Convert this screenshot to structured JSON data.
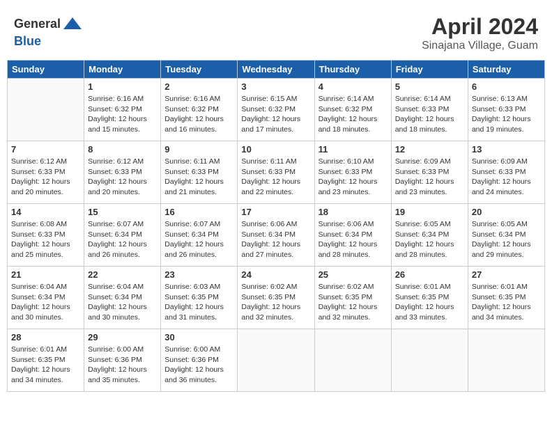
{
  "header": {
    "logo": {
      "line1": "General",
      "line2": "Blue"
    },
    "title": "April 2024",
    "location": "Sinajana Village, Guam"
  },
  "weekdays": [
    "Sunday",
    "Monday",
    "Tuesday",
    "Wednesday",
    "Thursday",
    "Friday",
    "Saturday"
  ],
  "weeks": [
    [
      {
        "day": "",
        "info": ""
      },
      {
        "day": "1",
        "info": "Sunrise: 6:16 AM\nSunset: 6:32 PM\nDaylight: 12 hours\nand 15 minutes."
      },
      {
        "day": "2",
        "info": "Sunrise: 6:16 AM\nSunset: 6:32 PM\nDaylight: 12 hours\nand 16 minutes."
      },
      {
        "day": "3",
        "info": "Sunrise: 6:15 AM\nSunset: 6:32 PM\nDaylight: 12 hours\nand 17 minutes."
      },
      {
        "day": "4",
        "info": "Sunrise: 6:14 AM\nSunset: 6:32 PM\nDaylight: 12 hours\nand 18 minutes."
      },
      {
        "day": "5",
        "info": "Sunrise: 6:14 AM\nSunset: 6:33 PM\nDaylight: 12 hours\nand 18 minutes."
      },
      {
        "day": "6",
        "info": "Sunrise: 6:13 AM\nSunset: 6:33 PM\nDaylight: 12 hours\nand 19 minutes."
      }
    ],
    [
      {
        "day": "7",
        "info": "Sunrise: 6:12 AM\nSunset: 6:33 PM\nDaylight: 12 hours\nand 20 minutes."
      },
      {
        "day": "8",
        "info": "Sunrise: 6:12 AM\nSunset: 6:33 PM\nDaylight: 12 hours\nand 20 minutes."
      },
      {
        "day": "9",
        "info": "Sunrise: 6:11 AM\nSunset: 6:33 PM\nDaylight: 12 hours\nand 21 minutes."
      },
      {
        "day": "10",
        "info": "Sunrise: 6:11 AM\nSunset: 6:33 PM\nDaylight: 12 hours\nand 22 minutes."
      },
      {
        "day": "11",
        "info": "Sunrise: 6:10 AM\nSunset: 6:33 PM\nDaylight: 12 hours\nand 23 minutes."
      },
      {
        "day": "12",
        "info": "Sunrise: 6:09 AM\nSunset: 6:33 PM\nDaylight: 12 hours\nand 23 minutes."
      },
      {
        "day": "13",
        "info": "Sunrise: 6:09 AM\nSunset: 6:33 PM\nDaylight: 12 hours\nand 24 minutes."
      }
    ],
    [
      {
        "day": "14",
        "info": "Sunrise: 6:08 AM\nSunset: 6:33 PM\nDaylight: 12 hours\nand 25 minutes."
      },
      {
        "day": "15",
        "info": "Sunrise: 6:07 AM\nSunset: 6:34 PM\nDaylight: 12 hours\nand 26 minutes."
      },
      {
        "day": "16",
        "info": "Sunrise: 6:07 AM\nSunset: 6:34 PM\nDaylight: 12 hours\nand 26 minutes."
      },
      {
        "day": "17",
        "info": "Sunrise: 6:06 AM\nSunset: 6:34 PM\nDaylight: 12 hours\nand 27 minutes."
      },
      {
        "day": "18",
        "info": "Sunrise: 6:06 AM\nSunset: 6:34 PM\nDaylight: 12 hours\nand 28 minutes."
      },
      {
        "day": "19",
        "info": "Sunrise: 6:05 AM\nSunset: 6:34 PM\nDaylight: 12 hours\nand 28 minutes."
      },
      {
        "day": "20",
        "info": "Sunrise: 6:05 AM\nSunset: 6:34 PM\nDaylight: 12 hours\nand 29 minutes."
      }
    ],
    [
      {
        "day": "21",
        "info": "Sunrise: 6:04 AM\nSunset: 6:34 PM\nDaylight: 12 hours\nand 30 minutes."
      },
      {
        "day": "22",
        "info": "Sunrise: 6:04 AM\nSunset: 6:34 PM\nDaylight: 12 hours\nand 30 minutes."
      },
      {
        "day": "23",
        "info": "Sunrise: 6:03 AM\nSunset: 6:35 PM\nDaylight: 12 hours\nand 31 minutes."
      },
      {
        "day": "24",
        "info": "Sunrise: 6:02 AM\nSunset: 6:35 PM\nDaylight: 12 hours\nand 32 minutes."
      },
      {
        "day": "25",
        "info": "Sunrise: 6:02 AM\nSunset: 6:35 PM\nDaylight: 12 hours\nand 32 minutes."
      },
      {
        "day": "26",
        "info": "Sunrise: 6:01 AM\nSunset: 6:35 PM\nDaylight: 12 hours\nand 33 minutes."
      },
      {
        "day": "27",
        "info": "Sunrise: 6:01 AM\nSunset: 6:35 PM\nDaylight: 12 hours\nand 34 minutes."
      }
    ],
    [
      {
        "day": "28",
        "info": "Sunrise: 6:01 AM\nSunset: 6:35 PM\nDaylight: 12 hours\nand 34 minutes."
      },
      {
        "day": "29",
        "info": "Sunrise: 6:00 AM\nSunset: 6:36 PM\nDaylight: 12 hours\nand 35 minutes."
      },
      {
        "day": "30",
        "info": "Sunrise: 6:00 AM\nSunset: 6:36 PM\nDaylight: 12 hours\nand 36 minutes."
      },
      {
        "day": "",
        "info": ""
      },
      {
        "day": "",
        "info": ""
      },
      {
        "day": "",
        "info": ""
      },
      {
        "day": "",
        "info": ""
      }
    ]
  ]
}
